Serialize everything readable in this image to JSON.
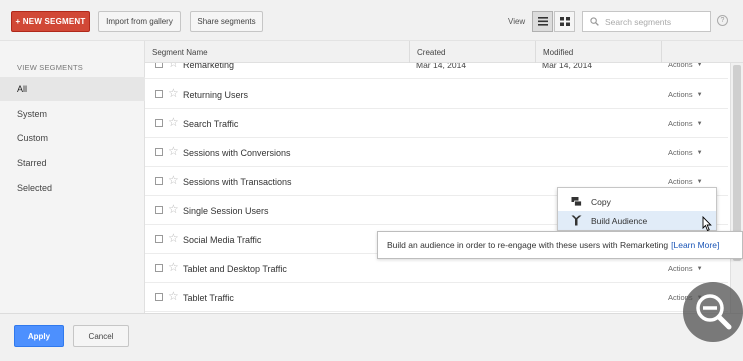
{
  "toolbar": {
    "new_segment_label": "+ NEW SEGMENT",
    "import_label": "Import from gallery",
    "share_label": "Share segments",
    "view_label": "View",
    "search_placeholder": "Search segments",
    "help_label": "?"
  },
  "sidebar": {
    "heading": "VIEW SEGMENTS",
    "items": [
      {
        "label": "All",
        "active": true
      },
      {
        "label": "System",
        "active": false
      },
      {
        "label": "Custom",
        "active": false
      },
      {
        "label": "Starred",
        "active": false
      },
      {
        "label": "Selected",
        "active": false
      }
    ]
  },
  "table": {
    "columns": {
      "name": "Segment Name",
      "created": "Created",
      "modified": "Modified"
    },
    "action_label": "Actions",
    "rows": [
      {
        "name": "Remarketing",
        "created": "Mar 14, 2014",
        "modified": "Mar 14, 2014"
      },
      {
        "name": "Returning Users",
        "created": "",
        "modified": ""
      },
      {
        "name": "Search Traffic",
        "created": "",
        "modified": ""
      },
      {
        "name": "Sessions with Conversions",
        "created": "",
        "modified": ""
      },
      {
        "name": "Sessions with Transactions",
        "created": "",
        "modified": ""
      },
      {
        "name": "Single Session Users",
        "created": "",
        "modified": ""
      },
      {
        "name": "Social Media Traffic",
        "created": "",
        "modified": ""
      },
      {
        "name": "Tablet and Desktop Traffic",
        "created": "",
        "modified": ""
      },
      {
        "name": "Tablet Traffic",
        "created": "",
        "modified": ""
      }
    ]
  },
  "actions_menu": {
    "copy_label": "Copy",
    "build_audience_label": "Build Audience"
  },
  "tooltip": {
    "text": "Build an audience in order to re-engage with these users with Remarketing",
    "link": "[Learn More]"
  },
  "footer": {
    "apply_label": "Apply",
    "cancel_label": "Cancel"
  },
  "colors": {
    "new_segment": "#d14836",
    "apply": "#4d90fe",
    "menu_hover": "#e1ecf8",
    "link": "#1a55b6"
  }
}
